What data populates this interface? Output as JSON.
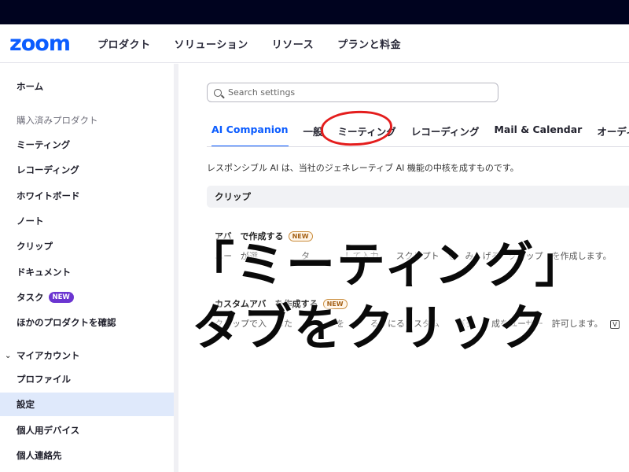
{
  "header": {
    "logo": "zoom",
    "nav": [
      "プロダクト",
      "ソリューション",
      "リソース",
      "プランと料金"
    ]
  },
  "sidebar": {
    "items": [
      {
        "label": "ホーム"
      },
      {
        "label": "購入済みプロダクト"
      },
      {
        "label": "ミーティング"
      },
      {
        "label": "レコーディング"
      },
      {
        "label": "ホワイトボード"
      },
      {
        "label": "ノート"
      },
      {
        "label": "クリップ"
      },
      {
        "label": "ドキュメント"
      },
      {
        "label": "タスク",
        "badge": "NEW"
      },
      {
        "label": "ほかのプロダクトを確認"
      },
      {
        "label": "マイアカウント"
      },
      {
        "label": "プロファイル"
      },
      {
        "label": "設定"
      },
      {
        "label": "個人用デバイス"
      },
      {
        "label": "個人連絡先"
      }
    ]
  },
  "search": {
    "placeholder": "Search settings"
  },
  "tabs": [
    "AI Companion",
    "一般",
    "ミーティング",
    "レコーディング",
    "Mail & Calendar",
    "オーディオ カ"
  ],
  "main": {
    "description": "レスポンシブル AI は、当社のジェネレーティブ AI 機能の中核を成すものです。",
    "section_title": "クリップ",
    "settings": [
      {
        "title": "アバ　で作成する",
        "badge": "NEW",
        "desc": "ユー　が選　　　　　タ　　　　して入力　　スクリプト　を　み　げる　クリップ　を作成します。"
      },
      {
        "title": "カスタムアバ　を作成する",
        "badge": "NEW",
        "desc": "クリップで入　した　　　　　を　　　る　にるカスタム　　バタ　　成をユーザー　許可します。",
        "icon": "V"
      }
    ]
  },
  "overlay": {
    "line1": "「ミーティング」",
    "line2": "タブをクリック"
  },
  "colors": {
    "accent": "#0b5cff",
    "annotation": "#e41d1d",
    "topbar": "#00031f"
  }
}
